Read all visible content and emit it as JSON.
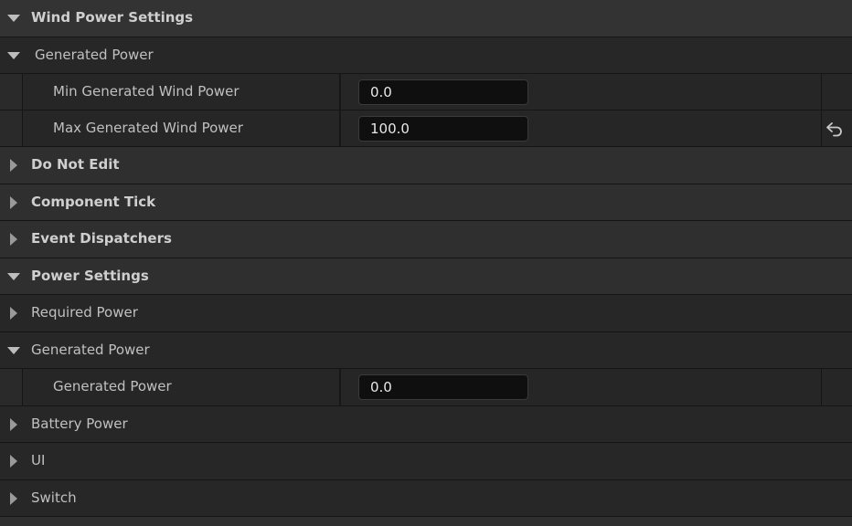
{
  "rows": {
    "wind_power_settings": "Wind Power Settings",
    "generated_power_group": "Generated Power",
    "min_generated_wind_power": {
      "label": "Min Generated Wind Power",
      "value": "0.0"
    },
    "max_generated_wind_power": {
      "label": "Max Generated Wind Power",
      "value": "100.0"
    },
    "do_not_edit": "Do Not Edit",
    "component_tick": "Component Tick",
    "event_dispatchers": "Event Dispatchers",
    "power_settings": "Power Settings",
    "required_power": "Required Power",
    "generated_power_sub": "Generated Power",
    "generated_power_prop": {
      "label": "Generated Power",
      "value": "0.0"
    },
    "battery_power": "Battery Power",
    "ui": "UI",
    "switch": "Switch"
  },
  "icons": {
    "reset": "reset-to-default-icon"
  }
}
